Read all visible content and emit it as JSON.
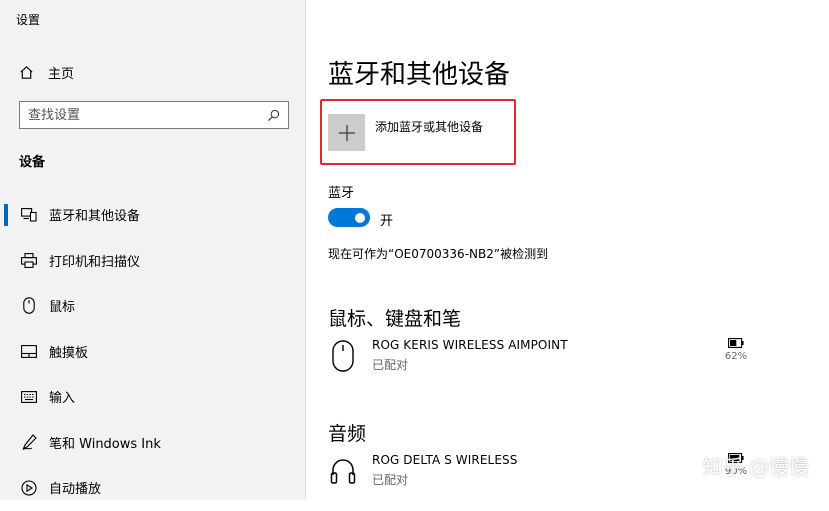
{
  "window": {
    "title": "设置"
  },
  "sidebar": {
    "home": {
      "label": "主页",
      "icon": "home-icon"
    },
    "search": {
      "placeholder": "查找设置",
      "icon": "search-icon"
    },
    "section_heading": "设备",
    "items": [
      {
        "label": "蓝牙和其他设备",
        "icon": "bluetooth-devices-icon",
        "active": true
      },
      {
        "label": "打印机和扫描仪",
        "icon": "printer-icon"
      },
      {
        "label": "鼠标",
        "icon": "mouse-icon"
      },
      {
        "label": "触摸板",
        "icon": "touchpad-icon"
      },
      {
        "label": "输入",
        "icon": "keyboard-icon"
      },
      {
        "label": "笔和 Windows Ink",
        "icon": "pen-icon"
      },
      {
        "label": "自动播放",
        "icon": "autoplay-icon"
      }
    ]
  },
  "main": {
    "title": "蓝牙和其他设备",
    "add_device": {
      "label": "添加蓝牙或其他设备",
      "icon": "plus-icon"
    },
    "bluetooth": {
      "label": "蓝牙",
      "toggle_state": "开",
      "on": true,
      "discoverable_text": "现在可作为“OE0700336-NB2”被检测到"
    },
    "groups": [
      {
        "heading": "鼠标、键盘和笔",
        "devices": [
          {
            "name": "ROG KERIS WIRELESS AIMPOINT",
            "status": "已配对",
            "battery": "62%",
            "icon": "mouse-icon"
          }
        ]
      },
      {
        "heading": "音频",
        "devices": [
          {
            "name": "ROG DELTA S WIRELESS",
            "status": "已配对",
            "battery": "90%",
            "icon": "headphones-icon"
          }
        ]
      }
    ]
  },
  "watermark": "知乎 @慢慢",
  "colors": {
    "accent": "#0078d7",
    "highlight_border": "#e0282d",
    "sidebar_bg": "#f2f2f2"
  }
}
